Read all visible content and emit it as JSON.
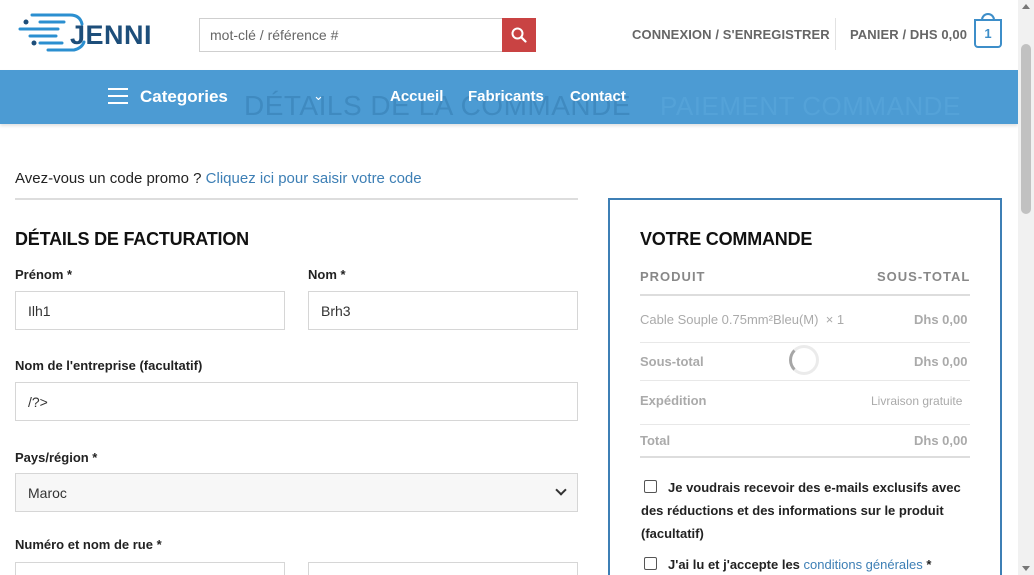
{
  "header": {
    "logo_text": "JENNI",
    "search_placeholder": "mot-clé / référence #",
    "login_label": "CONNEXION / S'ENREGISTRER",
    "cart_label": "PANIER / DHS 0,00",
    "cart_count": "1"
  },
  "nav": {
    "categories_label": "Categories",
    "links": [
      "Accueil",
      "Fabricants",
      "Contact"
    ],
    "ghost_title": "DÉTAILS DE LA COMMANDE",
    "ghost_steps": "PAIEMENT   COMMANDE"
  },
  "promo": {
    "question": "Avez-vous un code promo ? ",
    "link": "Cliquez ici pour saisir votre code"
  },
  "billing": {
    "title": "DÉTAILS DE FACTURATION",
    "first_name_label": "Prénom *",
    "first_name_value": "Ilh1",
    "last_name_label": "Nom *",
    "last_name_value": "Brh3",
    "company_label": "Nom de l'entreprise (facultatif)",
    "company_value": "/?>",
    "country_label": "Pays/région *",
    "country_value": "Maroc",
    "street_label": "Numéro et nom de rue *"
  },
  "order": {
    "title": "VOTRE COMMANDE",
    "col_product": "PRODUIT",
    "col_subtotal": "SOUS-TOTAL",
    "item_name": "Cable Souple 0.75mm²Bleu(M)",
    "item_qty": "× 1",
    "item_price": "Dhs 0,00",
    "subtotal_label": "Sous-total",
    "subtotal_value": "Dhs 0,00",
    "shipping_label": "Expédition",
    "shipping_value": "Livraison gratuite",
    "total_label": "Total",
    "total_value": "Dhs 0,00",
    "newsletter_text": "Je voudrais recevoir des e-mails exclusifs avec des réductions et des informations sur le produit (facultatif)",
    "terms_prefix": "J'ai lu et j'accepte les ",
    "terms_link": "conditions générales",
    "terms_suffix": " *"
  },
  "colors": {
    "nav_bg": "#4c9bd3",
    "accent": "#3d7fb5",
    "search_button": "#c94343"
  },
  "icons": {
    "search": "search-icon",
    "menu": "hamburger-icon",
    "chevron": "chevron-down-icon",
    "cart": "cart-icon",
    "spinner": "loading-spinner-icon"
  }
}
